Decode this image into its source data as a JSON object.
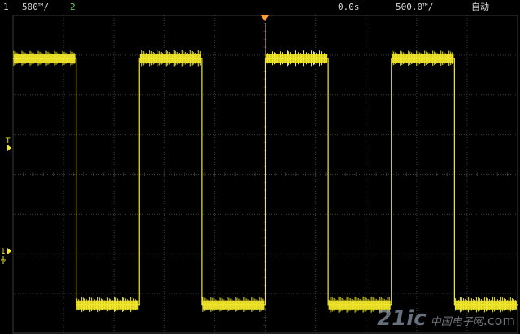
{
  "header": {
    "ch1_number": "1",
    "ch1_scale": "500™/",
    "ch2_number": "2",
    "time_offset": "0.0s",
    "time_scale": "500.0™/",
    "acq_mode": "自动"
  },
  "markers": {
    "trigger_level": "T",
    "ch1_ground": "1"
  },
  "watermark": {
    "brand": "21ic",
    "suffix": "中国电子网",
    "domain": ".com"
  },
  "waveform": {
    "type": "square",
    "high_fraction": 0.865,
    "low_fraction": 0.09,
    "period_divs": 2.5,
    "first_rise_div": 0.0
  },
  "colors": {
    "trace": "#f2e82a",
    "grid": "#3b3b3b",
    "trigger_marker": "#ff9a3c",
    "background": "#000000"
  }
}
